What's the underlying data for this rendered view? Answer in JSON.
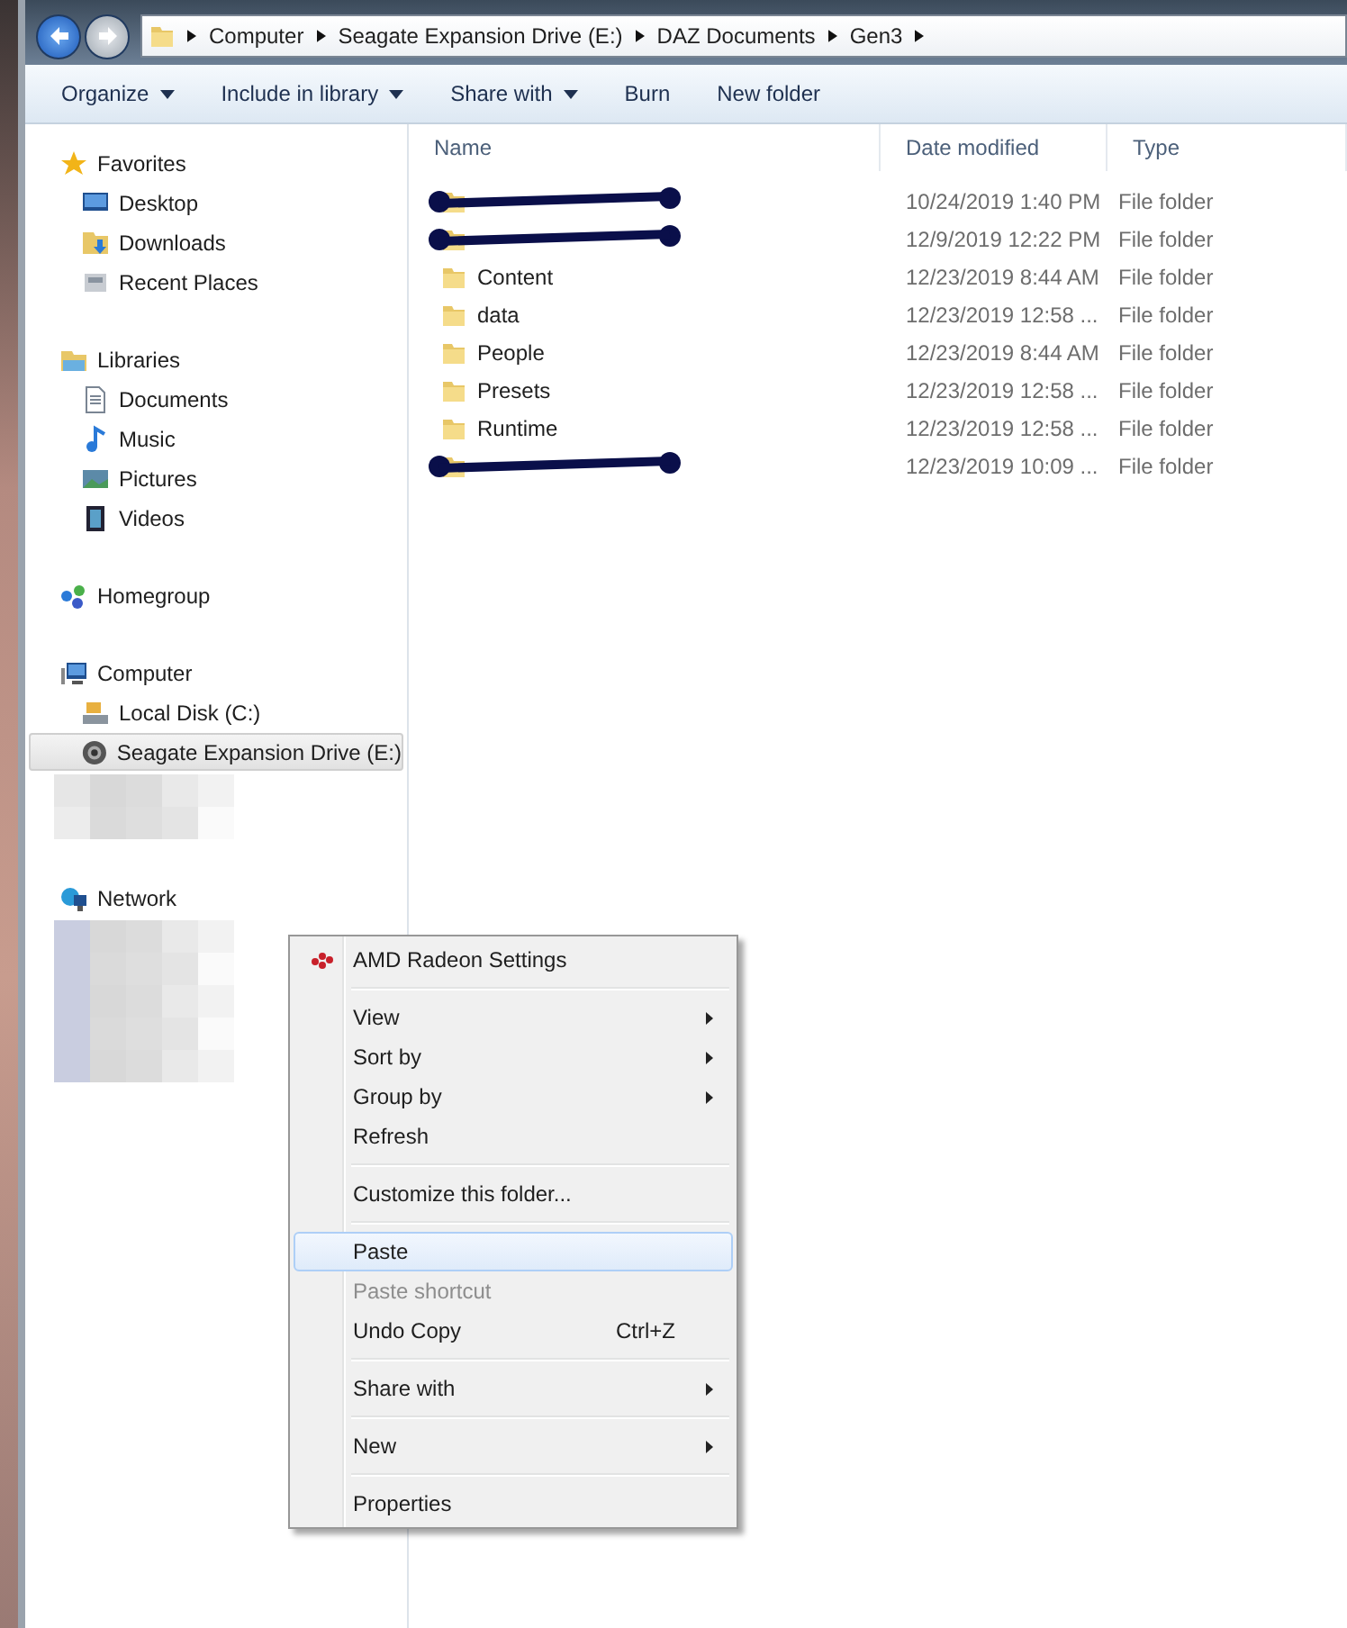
{
  "address_bar": {
    "crumbs": [
      "Computer",
      "Seagate Expansion Drive (E:)",
      "DAZ Documents",
      "Gen3"
    ]
  },
  "toolbar": {
    "buttons": [
      {
        "label": "Organize",
        "dropdown": true
      },
      {
        "label": "Include in library",
        "dropdown": true
      },
      {
        "label": "Share with",
        "dropdown": true
      },
      {
        "label": "Burn",
        "dropdown": false
      },
      {
        "label": "New folder",
        "dropdown": false
      }
    ]
  },
  "sidebar": {
    "groups": [
      {
        "label": "Favorites",
        "selected": false,
        "children": [
          {
            "label": "Desktop",
            "selected": false
          },
          {
            "label": "Downloads",
            "selected": false
          },
          {
            "label": "Recent Places",
            "selected": false
          }
        ]
      },
      {
        "label": "Libraries",
        "selected": false,
        "children": [
          {
            "label": "Documents",
            "selected": false
          },
          {
            "label": "Music",
            "selected": false
          },
          {
            "label": "Pictures",
            "selected": false
          },
          {
            "label": "Videos",
            "selected": false
          }
        ]
      },
      {
        "label": "Homegroup",
        "selected": false
      },
      {
        "label": "Computer",
        "selected": false,
        "children": [
          {
            "label": "Local Disk (C:)",
            "selected": false
          },
          {
            "label": "Seagate Expansion Drive (E:)",
            "selected": true
          }
        ]
      },
      {
        "label": "Network",
        "selected": false
      }
    ]
  },
  "table": {
    "columns": [
      "Name",
      "Date modified",
      "Type"
    ],
    "rows": [
      {
        "redacted": true,
        "date": "10/24/2019 1:40 PM",
        "type": "File folder"
      },
      {
        "redacted": true,
        "date": "12/9/2019 12:22 PM",
        "type": "File folder"
      },
      {
        "name": "Content",
        "date": "12/23/2019 8:44 AM",
        "type": "File folder"
      },
      {
        "name": "data",
        "date": "12/23/2019 12:58 ...",
        "type": "File folder"
      },
      {
        "name": "People",
        "date": "12/23/2019 8:44 AM",
        "type": "File folder"
      },
      {
        "name": "Presets",
        "date": "12/23/2019 12:58 ...",
        "type": "File folder"
      },
      {
        "name": "Runtime",
        "date": "12/23/2019 12:58 ...",
        "type": "File folder"
      },
      {
        "redacted": true,
        "date": "12/23/2019 10:09 ...",
        "type": "File folder"
      }
    ]
  },
  "context_menu": {
    "items": [
      {
        "kind": "item",
        "label": "AMD Radeon Settings",
        "submenu": false,
        "disabled": false,
        "selected": false
      },
      {
        "kind": "separator"
      },
      {
        "kind": "item",
        "label": "View",
        "submenu": true,
        "disabled": false,
        "selected": false
      },
      {
        "kind": "item",
        "label": "Sort by",
        "submenu": true,
        "disabled": false,
        "selected": false
      },
      {
        "kind": "item",
        "label": "Group by",
        "submenu": true,
        "disabled": false,
        "selected": false
      },
      {
        "kind": "item",
        "label": "Refresh",
        "submenu": false,
        "disabled": false,
        "selected": false
      },
      {
        "kind": "separator"
      },
      {
        "kind": "item",
        "label": "Customize this folder...",
        "submenu": false,
        "disabled": false,
        "selected": false
      },
      {
        "kind": "separator"
      },
      {
        "kind": "item",
        "label": "Paste",
        "submenu": false,
        "disabled": false,
        "selected": true
      },
      {
        "kind": "item",
        "label": "Paste shortcut",
        "submenu": false,
        "disabled": true,
        "selected": false
      },
      {
        "kind": "item",
        "label": "Undo Copy",
        "shortcut": "Ctrl+Z",
        "submenu": false,
        "disabled": false,
        "selected": false
      },
      {
        "kind": "separator"
      },
      {
        "kind": "item",
        "label": "Share with",
        "submenu": true,
        "disabled": false,
        "selected": false
      },
      {
        "kind": "separator"
      },
      {
        "kind": "item",
        "label": "New",
        "submenu": true,
        "disabled": false,
        "selected": false
      },
      {
        "kind": "separator"
      },
      {
        "kind": "item",
        "label": "Properties",
        "submenu": false,
        "disabled": false,
        "selected": false
      }
    ]
  }
}
